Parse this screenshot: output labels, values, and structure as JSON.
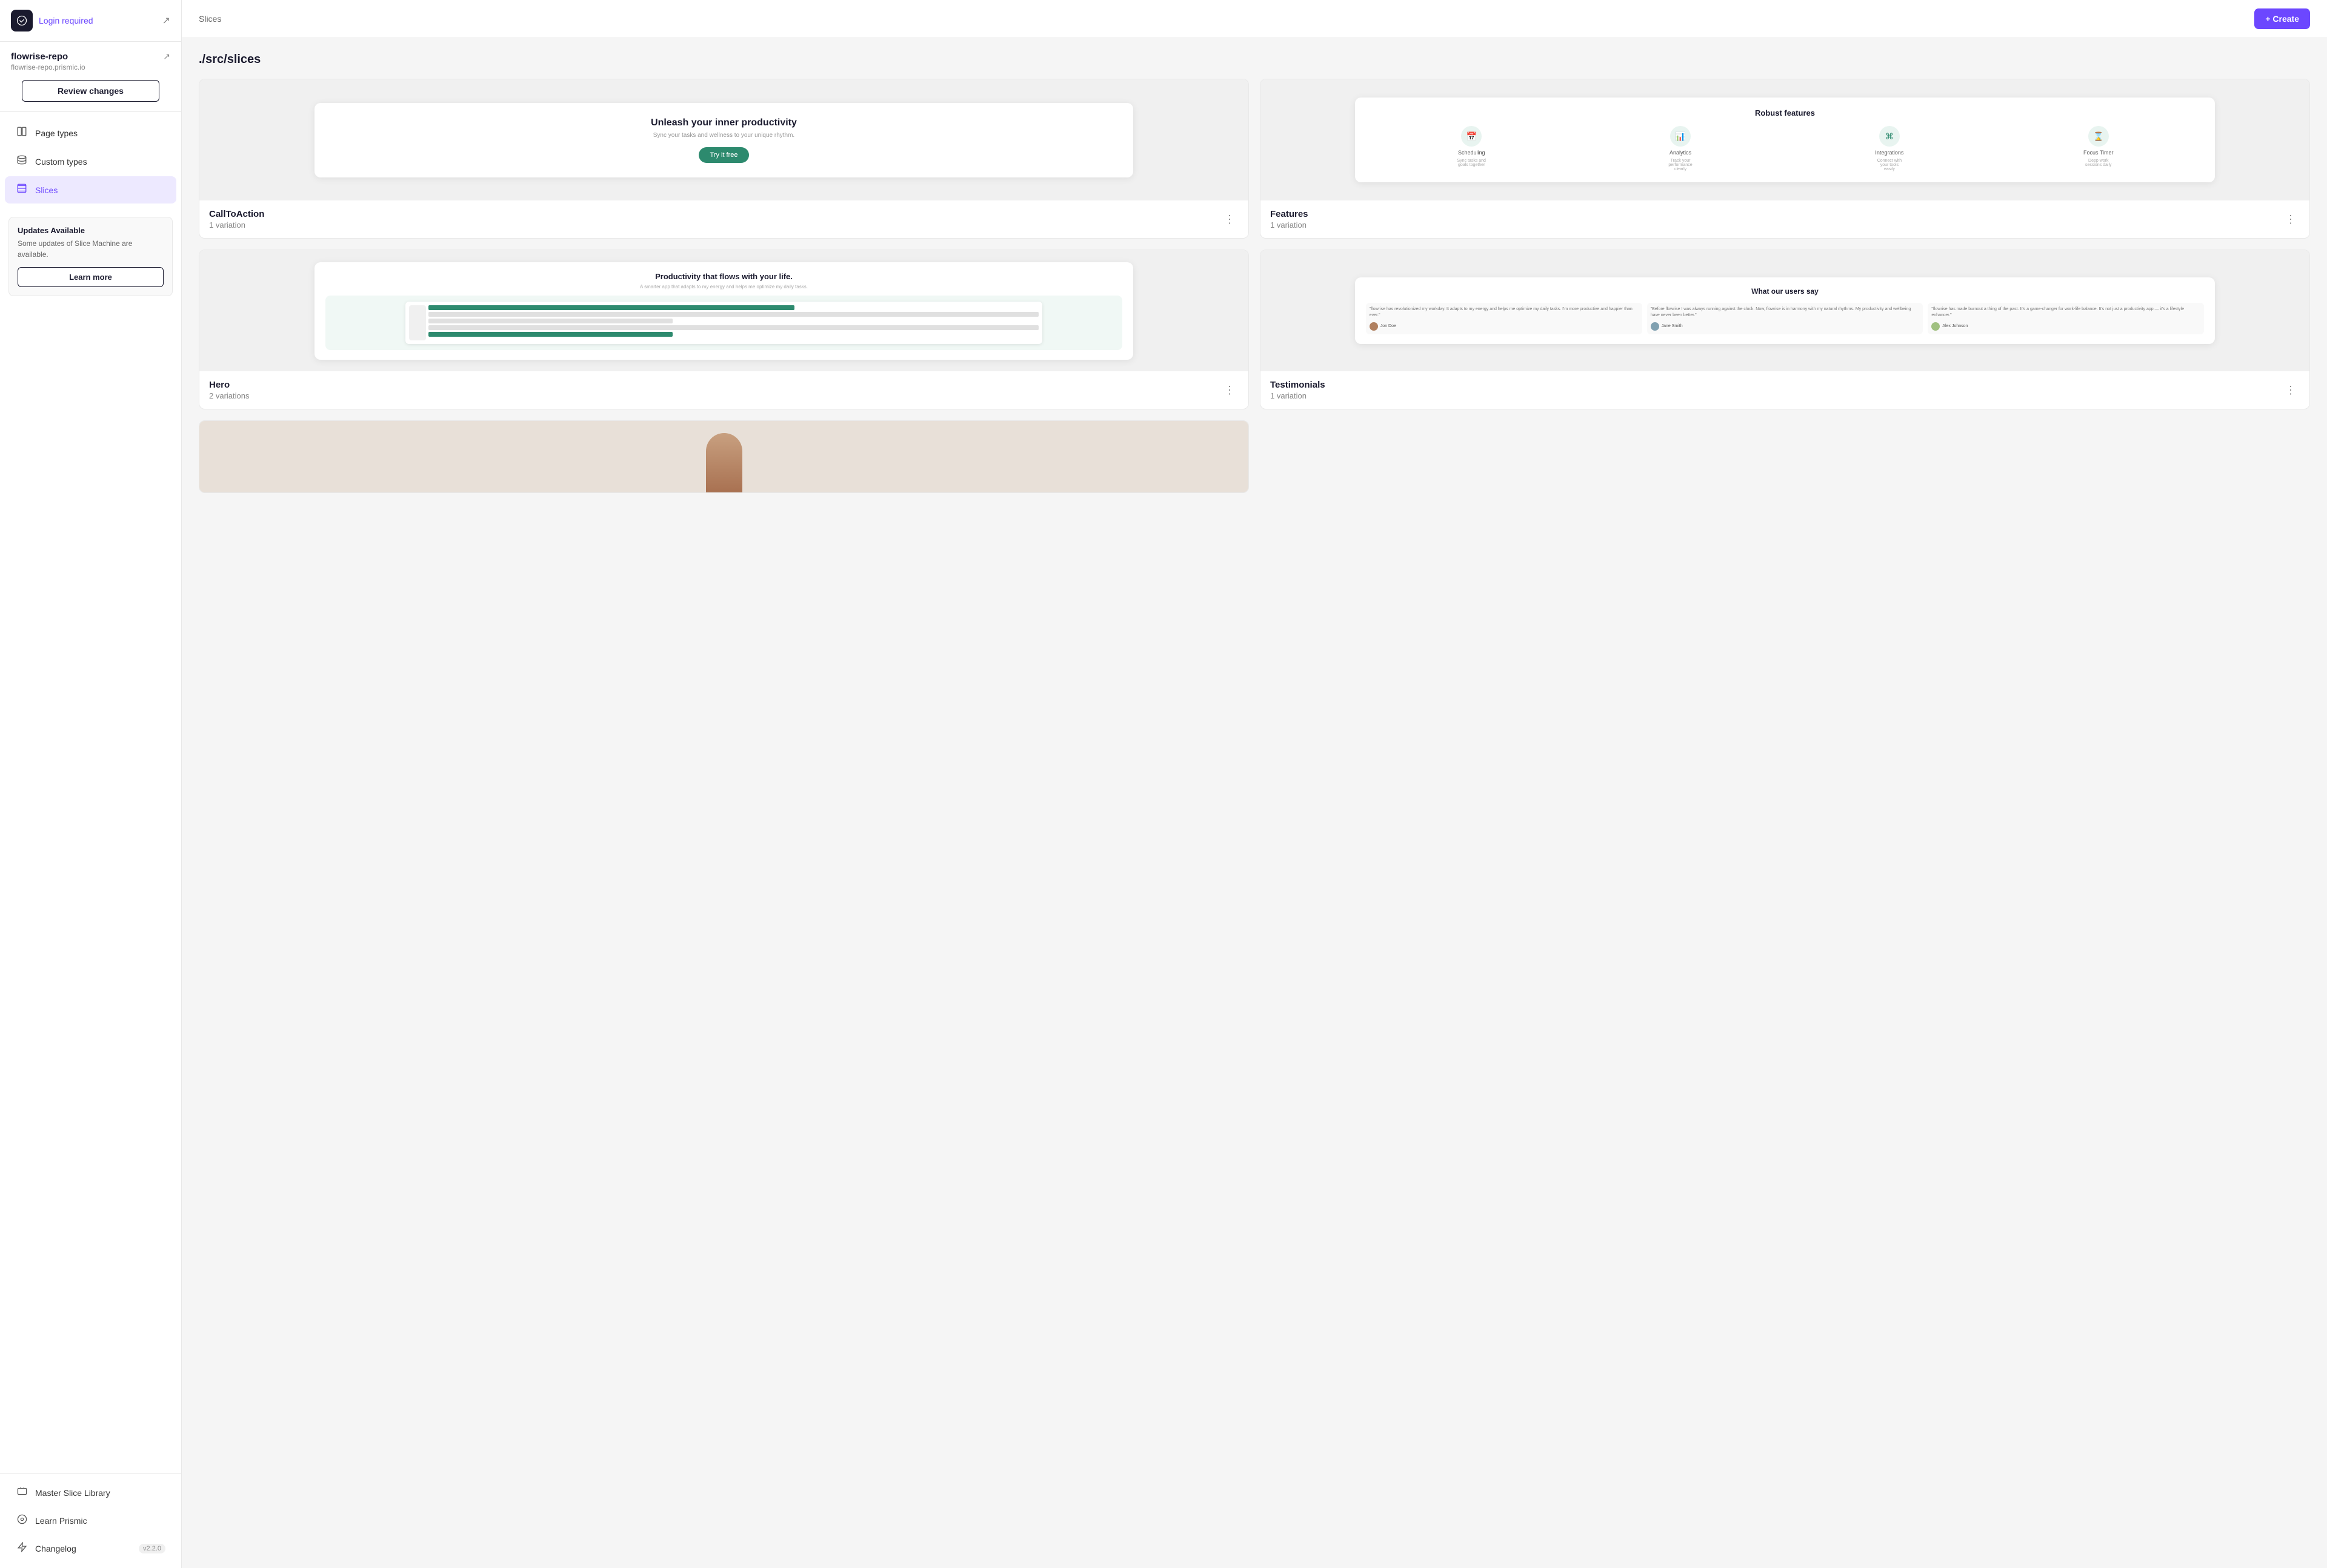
{
  "sidebar": {
    "logo_alt": "Prismic logo",
    "login_text": "Login required",
    "export_icon": "↗",
    "repo_name": "flowrise-repo",
    "repo_url": "flowrise-repo.prismic.io",
    "external_icon": "↗",
    "review_changes_label": "Review changes",
    "nav_items": [
      {
        "id": "page-types",
        "label": "Page types",
        "icon": "⊟"
      },
      {
        "id": "custom-types",
        "label": "Custom types",
        "icon": "🗄"
      },
      {
        "id": "slices",
        "label": "Slices",
        "icon": "📁",
        "active": true
      }
    ],
    "updates_card": {
      "title": "Updates Available",
      "description": "Some updates of Slice Machine are available.",
      "learn_more_label": "Learn more"
    },
    "bottom_items": [
      {
        "id": "master-slice-library",
        "label": "Master Slice Library",
        "icon": "🖥"
      },
      {
        "id": "learn-prismic",
        "label": "Learn Prismic",
        "icon": "⊙"
      },
      {
        "id": "changelog",
        "label": "Changelog",
        "icon": "⚡",
        "version": "v2.2.0"
      }
    ]
  },
  "main": {
    "header_title": "Slices",
    "create_button_label": "+ Create",
    "path": "./src/slices",
    "slices": [
      {
        "id": "cta",
        "name": "CallToAction",
        "variations": "1 variation",
        "preview_type": "cta",
        "preview": {
          "title": "Unleash your inner productivity",
          "subtitle": "Sync your tasks and wellness to your unique rhythm.",
          "button_label": "Try it free"
        }
      },
      {
        "id": "features",
        "name": "Features",
        "variations": "1 variation",
        "preview_type": "features",
        "preview": {
          "title": "Robust features",
          "items": [
            {
              "label": "Scheduling",
              "icon": "📅"
            },
            {
              "label": "Analytics",
              "icon": "📊"
            },
            {
              "label": "Integrations",
              "icon": "⌘"
            },
            {
              "label": "Focus Timer",
              "icon": "⌛"
            }
          ]
        }
      },
      {
        "id": "hero",
        "name": "Hero",
        "variations": "2 variations",
        "preview_type": "hero",
        "preview": {
          "title": "Productivity that flows with your life.",
          "subtitle": "A smarter app that adapts to my energy and helps me optimize my daily tasks."
        }
      },
      {
        "id": "testimonials",
        "name": "Testimonials",
        "variations": "1 variation",
        "preview_type": "testimonials",
        "preview": {
          "title": "What our users say",
          "cards": [
            {
              "text": "\"flowrise has revolutionized my workday. It adapts to my energy and helps me optimize my daily tasks. I'm more productive and happier than ever.\"",
              "author": "Jon Doe"
            },
            {
              "text": "\"Before flowrise I was always running against the clock. Now, flowrise is in harmony with my natural rhythms. My productivity and wellbeing have never been better.\"",
              "author": "Jane Smith"
            },
            {
              "text": "\"flowrise has made burnout a thing of the past. It's a game-changer for work-life balance. It's not just a productivity app — it's a lifestyle enhancer.\"",
              "author": "Alex Johnson"
            }
          ]
        }
      },
      {
        "id": "partial",
        "name": "",
        "variations": "",
        "preview_type": "partial"
      }
    ]
  }
}
